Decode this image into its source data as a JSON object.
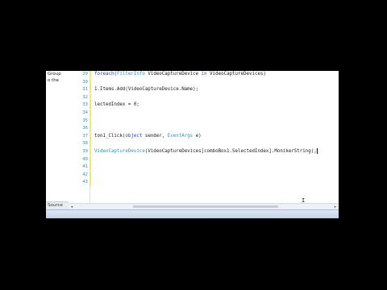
{
  "left_panel": {
    "line1": "Group",
    "line2": "o the",
    "bottom_tab": "Source"
  },
  "editor": {
    "lines": [
      {
        "num": "29",
        "parts": [
          [
            "kw",
            "foreach"
          ],
          [
            "",
            "("
          ],
          [
            "tp",
            "FilterInfo"
          ],
          [
            "",
            " VideoCaptureDevice "
          ],
          [
            "kw",
            "in"
          ],
          [
            "",
            " VideoCaptureDevices)"
          ]
        ]
      },
      {
        "num": "30",
        "parts": []
      },
      {
        "num": "31",
        "parts": [
          [
            "",
            "1.Items.Add(VideoCaptureDevice.Name);"
          ]
        ]
      },
      {
        "num": "32",
        "parts": []
      },
      {
        "num": "33",
        "parts": [
          [
            "",
            "lectedIndex = 0;"
          ]
        ]
      },
      {
        "num": "34",
        "parts": []
      },
      {
        "num": "35",
        "parts": []
      },
      {
        "num": "36",
        "parts": []
      },
      {
        "num": "37",
        "parts": [
          [
            "",
            "ton1_Click("
          ],
          [
            "kw",
            "object"
          ],
          [
            "",
            " sender, "
          ],
          [
            "tp",
            "EventArgs"
          ],
          [
            "",
            " e)"
          ]
        ]
      },
      {
        "num": "38",
        "parts": []
      },
      {
        "num": "39",
        "parts": [
          [
            "",
            ""
          ],
          [
            "tp",
            "VideoCaptureDevice"
          ],
          [
            "",
            "(VideoCaptureDevices[comboBox1.SelectedIndex].MonikerString);"
          ]
        ]
      },
      {
        "num": "40",
        "parts": []
      },
      {
        "num": "41",
        "parts": []
      },
      {
        "num": "42",
        "parts": []
      },
      {
        "num": "43",
        "parts": []
      }
    ]
  },
  "icons": {
    "text_cursor": "I"
  }
}
